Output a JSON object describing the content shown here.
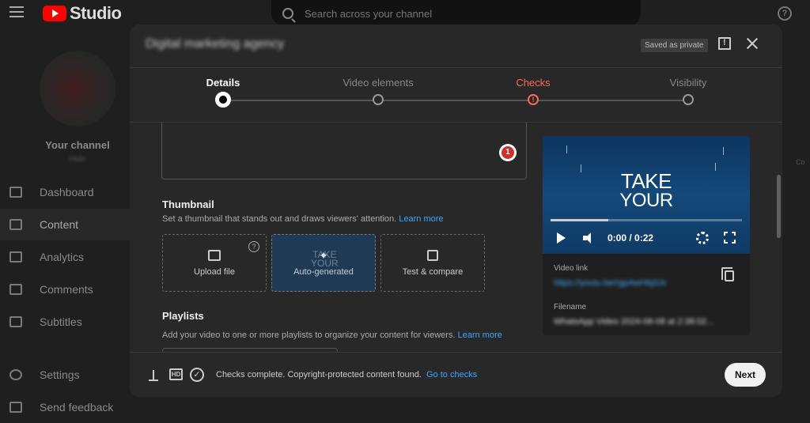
{
  "app": {
    "logo_text": "Studio"
  },
  "search": {
    "placeholder": "Search across your channel"
  },
  "sidebar": {
    "channel_title": "Your channel",
    "channel_name": "Hulx",
    "items": [
      {
        "label": "Dashboard",
        "icon": "dashboard-icon"
      },
      {
        "label": "Content",
        "icon": "content-icon"
      },
      {
        "label": "Analytics",
        "icon": "analytics-icon"
      },
      {
        "label": "Comments",
        "icon": "comments-icon"
      },
      {
        "label": "Subtitles",
        "icon": "subtitles-icon"
      },
      {
        "label": "Settings",
        "icon": "settings-icon"
      },
      {
        "label": "Send feedback",
        "icon": "feedback-icon"
      }
    ],
    "active_item": "Content"
  },
  "dialog": {
    "title": "Digital marketing agency",
    "saved_badge": "Saved as private",
    "steps": [
      {
        "label": "Details",
        "state": "active"
      },
      {
        "label": "Video elements",
        "state": "pending"
      },
      {
        "label": "Checks",
        "state": "error",
        "marker": "!"
      },
      {
        "label": "Visibility",
        "state": "pending"
      }
    ],
    "description_badge": "1",
    "thumbnail": {
      "title": "Thumbnail",
      "description": "Set a thumbnail that stands out and draws viewers' attention.",
      "learn_more": "Learn more",
      "options": [
        {
          "label": "Upload file"
        },
        {
          "label": "Auto-generated",
          "preview_text_1": "TAKE",
          "preview_text_2": "YOUR"
        },
        {
          "label": "Test & compare"
        }
      ],
      "help": "?"
    },
    "playlists": {
      "title": "Playlists",
      "description": "Add your video to one or more playlists to organize your content for viewers.",
      "learn_more": "Learn more"
    },
    "video": {
      "text_line1": "TAKE",
      "text_line2": "YOUR",
      "time": "0:00 / 0:22",
      "progress": 0.3,
      "link_label": "Video link",
      "link_value": "https://youtu.be/rgpAwHbj3Jc",
      "filename_label": "Filename",
      "filename_value": "WhatsApp Video 2024-08-08 at 2:38:02..."
    },
    "footer": {
      "hd_label": "HD",
      "check_mark": "✓",
      "status": "Checks complete. Copyright-protected content found.",
      "go_to_checks": "Go to checks",
      "next_label": "Next"
    }
  },
  "right_edge_text": "Co"
}
